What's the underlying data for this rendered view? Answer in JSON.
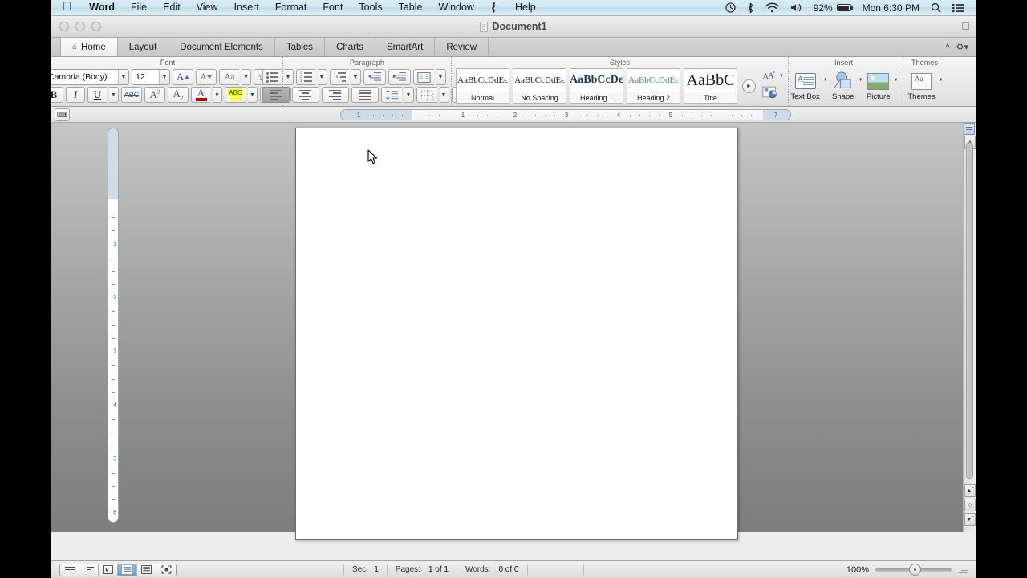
{
  "menubar": {
    "apple_icon": "apple-icon",
    "items": [
      {
        "label": "Word",
        "bold": true
      },
      {
        "label": "File",
        "bold": false
      },
      {
        "label": "Edit",
        "bold": false
      },
      {
        "label": "View",
        "bold": false
      },
      {
        "label": "Insert",
        "bold": false
      },
      {
        "label": "Format",
        "bold": false
      },
      {
        "label": "Font",
        "bold": false
      },
      {
        "label": "Tools",
        "bold": false
      },
      {
        "label": "Table",
        "bold": false
      },
      {
        "label": "Window",
        "bold": false
      },
      {
        "label": "Help",
        "bold": false
      }
    ],
    "status": {
      "time_machine_icon": "clock-icon",
      "bluetooth_icon": "bluetooth-icon",
      "wifi_icon": "wifi-icon",
      "volume_icon": "volume-icon",
      "battery_percent": "92%",
      "clock": "Mon 6:30 PM",
      "search_icon": "search-icon",
      "notification_icon": "notification-center-icon"
    }
  },
  "window": {
    "title": "Document1",
    "lights": [
      "close-button",
      "minimize-button",
      "zoom-button"
    ]
  },
  "tabs": [
    {
      "label": "Home",
      "active": true,
      "icon": "home-icon"
    },
    {
      "label": "Layout",
      "active": false
    },
    {
      "label": "Document Elements",
      "active": false
    },
    {
      "label": "Tables",
      "active": false
    },
    {
      "label": "Charts",
      "active": false
    },
    {
      "label": "SmartArt",
      "active": false
    },
    {
      "label": "Review",
      "active": false
    }
  ],
  "ribbon": {
    "font": {
      "title": "Font",
      "font_name": "Cambria (Body)",
      "font_size": "12",
      "grow_label": "A",
      "shrink_label": "A",
      "case_label": "Aa",
      "clear_label": "Ab",
      "bold": "B",
      "italic": "I",
      "underline": "U",
      "strikethrough": "ABC",
      "superscript": "A",
      "superscript_sup": "2",
      "subscript": "A",
      "subscript_sub": "2",
      "font_color": "A",
      "font_color_hex": "#c00000",
      "highlight": "ABC",
      "highlight_hex": "#ffff00",
      "text_effects": "A"
    },
    "paragraph": {
      "title": "Paragraph",
      "bullets": "bulleted-list",
      "numbering": "numbered-list",
      "multilevel": "multilevel-list",
      "decrease_indent": "decrease-indent",
      "increase_indent": "increase-indent",
      "columns": "columns",
      "align_left": "align-left",
      "align_center": "align-center",
      "align_right": "align-right",
      "justify": "justify",
      "line_spacing": "line-spacing",
      "borders": "borders",
      "sort": "sort-az"
    },
    "styles": {
      "title": "Styles",
      "items": [
        {
          "preview": "AaBbCcDdEє",
          "name": "Normal",
          "size": "11px",
          "weight": "normal",
          "color": "#1a1a1a"
        },
        {
          "preview": "AaBbCcDdEє",
          "name": "No Spacing",
          "size": "11px",
          "weight": "normal",
          "color": "#1a1a1a"
        },
        {
          "preview": "AaBbCcDє",
          "name": "Heading 1",
          "size": "14px",
          "weight": "bold",
          "color": "#1f3864"
        },
        {
          "preview": "AaBbCcDdEє",
          "name": "Heading 2",
          "size": "11px",
          "weight": "normal",
          "color": "#4a7ebb"
        },
        {
          "preview": "AaBbC",
          "name": "Title",
          "size": "20px",
          "weight": "normal",
          "color": "#1a1a1a"
        }
      ],
      "scroll_more": "▶",
      "manage_styles_icon": "styles-pane-icon",
      "style_inspector_icon": "style-inspector-icon"
    },
    "insert": {
      "title": "Insert",
      "items": [
        {
          "label": "Text Box",
          "icon": "text-box-icon"
        },
        {
          "label": "Shape",
          "icon": "shape-icon"
        },
        {
          "label": "Picture",
          "icon": "picture-icon"
        }
      ]
    },
    "themes": {
      "title": "Themes",
      "items": [
        {
          "label": "Themes",
          "icon": "themes-icon"
        }
      ]
    },
    "collapse_icon": "collapse-ribbon-icon",
    "settings_icon": "ribbon-settings-icon"
  },
  "ruler": {
    "toolbox_icon": "toolbox-button",
    "h_numbers": [
      "1",
      "1",
      "2",
      "3",
      "4",
      "5",
      "7"
    ],
    "v_numbers": [
      "1",
      "2",
      "3",
      "4",
      "5",
      "6"
    ]
  },
  "statusbar": {
    "view_buttons": [
      {
        "name": "draft-view",
        "active": false
      },
      {
        "name": "outline-view",
        "active": false
      },
      {
        "name": "publishing-layout-view",
        "active": false
      },
      {
        "name": "print-layout-view",
        "active": true
      },
      {
        "name": "notebook-layout-view",
        "active": false
      },
      {
        "name": "focus-view",
        "active": false
      }
    ],
    "section_label": "Sec",
    "section_value": "1",
    "pages_label": "Pages:",
    "pages_value": "1 of 1",
    "words_label": "Words:",
    "words_value": "0 of 0",
    "zoom_value": "100%"
  },
  "scrollbar": {
    "prev_page_icon": "previous-page-icon",
    "browse_object_icon": "select-browse-object-icon",
    "next_page_icon": "next-page-icon",
    "split_icon": "split-window-icon"
  },
  "colors": {
    "menubar_accent": "#cfe8f1",
    "selection_blue": "#6f9fc9",
    "ruler_margin": "#cfdce8",
    "canvas_top": "#c9c9c9",
    "canvas_bottom": "#7d7d7d"
  }
}
